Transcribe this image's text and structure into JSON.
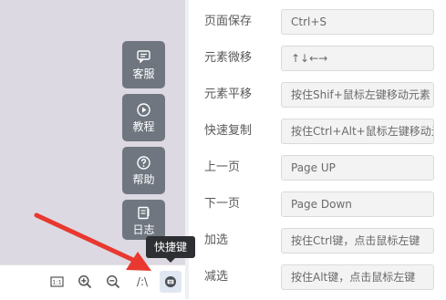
{
  "side_buttons": [
    {
      "label": "客服",
      "icon": "chat-icon"
    },
    {
      "label": "教程",
      "icon": "play-icon"
    },
    {
      "label": "帮助",
      "icon": "help-icon"
    },
    {
      "label": "日志",
      "icon": "log-icon"
    }
  ],
  "toolbar": {
    "icons": [
      "fit-screen-icon",
      "zoom-in-icon",
      "zoom-out-icon",
      "grid-toggle-icon",
      "keyboard-shortcut-icon"
    ],
    "grid_label": "/:\\",
    "tooltip": "快捷键"
  },
  "shortcuts": [
    {
      "name": "页面保存",
      "key": "Ctrl+S"
    },
    {
      "name": "元素微移",
      "key": "↑↓←→"
    },
    {
      "name": "元素平移",
      "key": "按住Shif+鼠标左键移动元素"
    },
    {
      "name": "快速复制",
      "key": "按住Ctrl+Alt+鼠标左键移动元素"
    },
    {
      "name": "上一页",
      "key": "Page UP"
    },
    {
      "name": "下一页",
      "key": "Page Down"
    },
    {
      "name": "加选",
      "key": "按住Ctrl键，点击鼠标左键"
    },
    {
      "name": "减选",
      "key": "按住Alt键，点击鼠标左键"
    }
  ],
  "colors": {
    "canvas": "#dcd9e2",
    "side_button": "#6f7680",
    "tooltip": "#2e2f33",
    "annotation_arrow": "#e8382f"
  }
}
